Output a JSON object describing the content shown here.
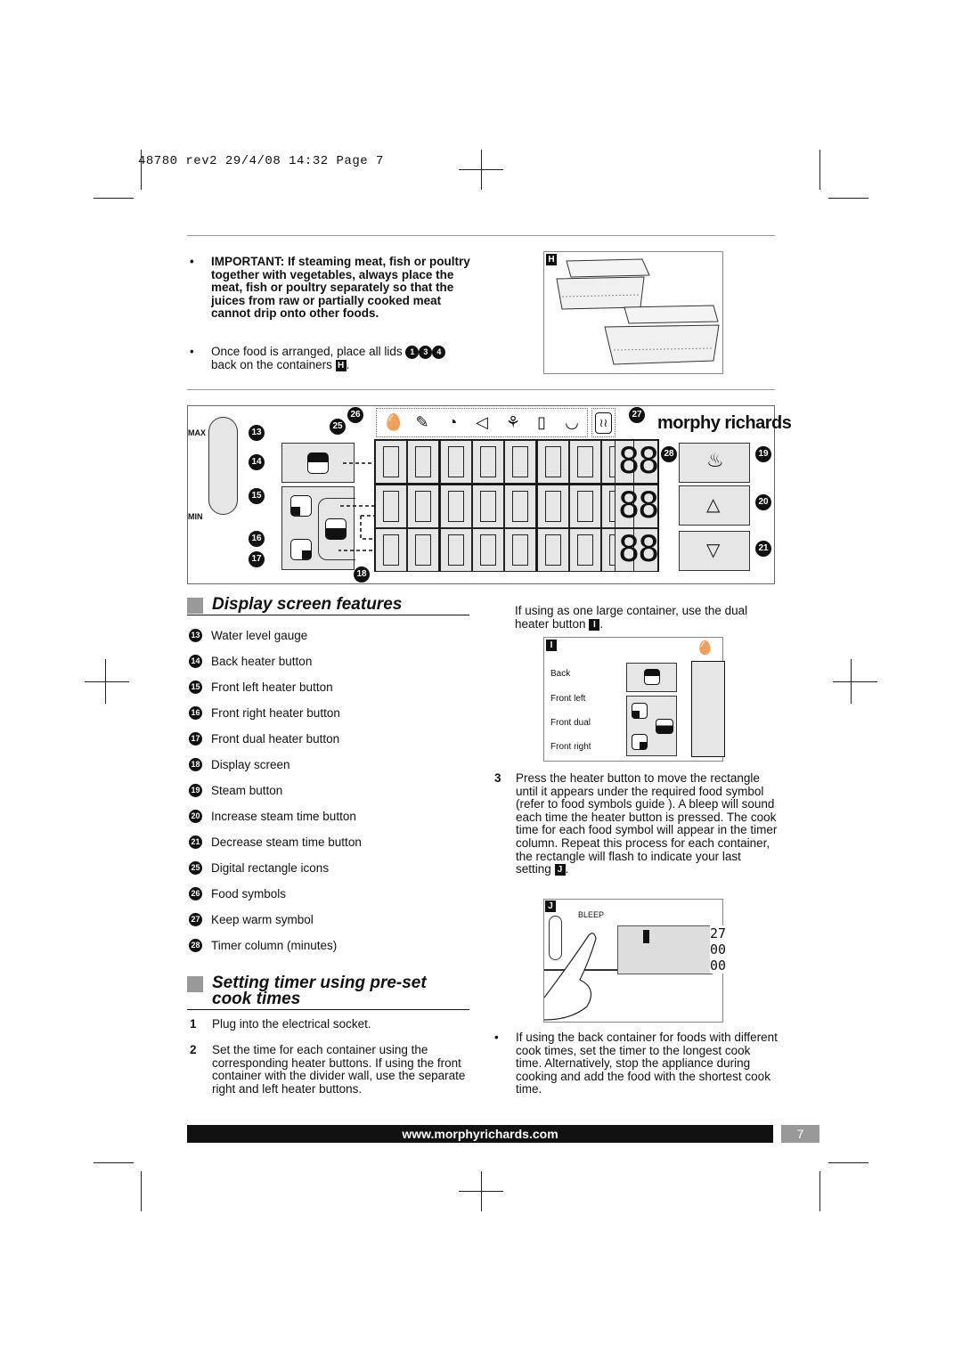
{
  "header": "48780 rev2 29/4/08 14:32 Page 7",
  "top": {
    "important": "IMPORTANT: If steaming meat, fish or poultry together with vegetables, always place the meat, fish or poultry separately so that the juices from raw or partially cooked meat cannot drip onto other foods.",
    "lids_text": "Once food is arranged, place all lids",
    "lids_nums": [
      "1",
      "3",
      "4"
    ],
    "lids_text2": "back on the containers",
    "fig_label": "H"
  },
  "diagram": {
    "max": "MAX",
    "min": "MIN",
    "brand": "morphy richards",
    "callouts": {
      "c13": "13",
      "c14": "14",
      "c15": "15",
      "c16": "16",
      "c17": "17",
      "c18": "18",
      "c19": "19",
      "c20": "20",
      "c21": "21",
      "c25": "25",
      "c26": "26",
      "c27": "27",
      "c28": "28"
    },
    "digits": "88",
    "food_symbols": [
      "egg-icon",
      "vegetable-icon",
      "poultry-icon",
      "fish-icon",
      "vegetables-icon",
      "jar-icon",
      "rice-bowl-icon"
    ],
    "keep_warm_symbol": "keep-warm-icon"
  },
  "section1": {
    "title": "Display screen features",
    "items": [
      {
        "n": "13",
        "label": "Water level gauge"
      },
      {
        "n": "14",
        "label": "Back heater button"
      },
      {
        "n": "15",
        "label": "Front left heater button"
      },
      {
        "n": "16",
        "label": "Front right heater button"
      },
      {
        "n": "17",
        "label": "Front dual heater button"
      },
      {
        "n": "18",
        "label": "Display screen"
      },
      {
        "n": "19",
        "label": "Steam button"
      },
      {
        "n": "20",
        "label": "Increase steam time button"
      },
      {
        "n": "21",
        "label": "Decrease steam time button"
      },
      {
        "n": "25",
        "label": "Digital rectangle icons"
      },
      {
        "n": "26",
        "label": "Food symbols"
      },
      {
        "n": "27",
        "label": "Keep warm symbol"
      },
      {
        "n": "28",
        "label": "Timer column (minutes)"
      }
    ]
  },
  "section2": {
    "title_line1": "Setting timer using pre-set",
    "title_line2": "cook times",
    "steps": [
      {
        "n": "1",
        "text": "Plug into the electrical socket."
      },
      {
        "n": "2",
        "text": "Set the time for each container using the corresponding heater buttons. If using the front container with the divider wall, use the separate right and left heater buttons."
      }
    ]
  },
  "right": {
    "dual_text": "If using as one large container, use the dual heater button",
    "fig_i": {
      "label": "I",
      "labels": [
        "Back",
        "Front left",
        "Front dual",
        "Front right"
      ]
    },
    "step3_n": "3",
    "step3": "Press the heater button to move the rectangle  until it appears under the required food symbol (refer to food symbols guide ). A bleep will sound each time the heater button is pressed. The cook time for each food symbol will appear in the timer column. Repeat this process for each container, the rectangle will flash to indicate your last setting",
    "fig_j": {
      "label": "J",
      "bleep": "BLEEP",
      "times": [
        "27",
        "00",
        "00"
      ]
    },
    "bullet": "If using the back container for foods with different cook times, set the timer to the longest cook time. Alternatively, stop the appliance during cooking and add the food with the shortest cook time."
  },
  "footer": {
    "url": "www.morphyrichards.com",
    "page": "7"
  }
}
